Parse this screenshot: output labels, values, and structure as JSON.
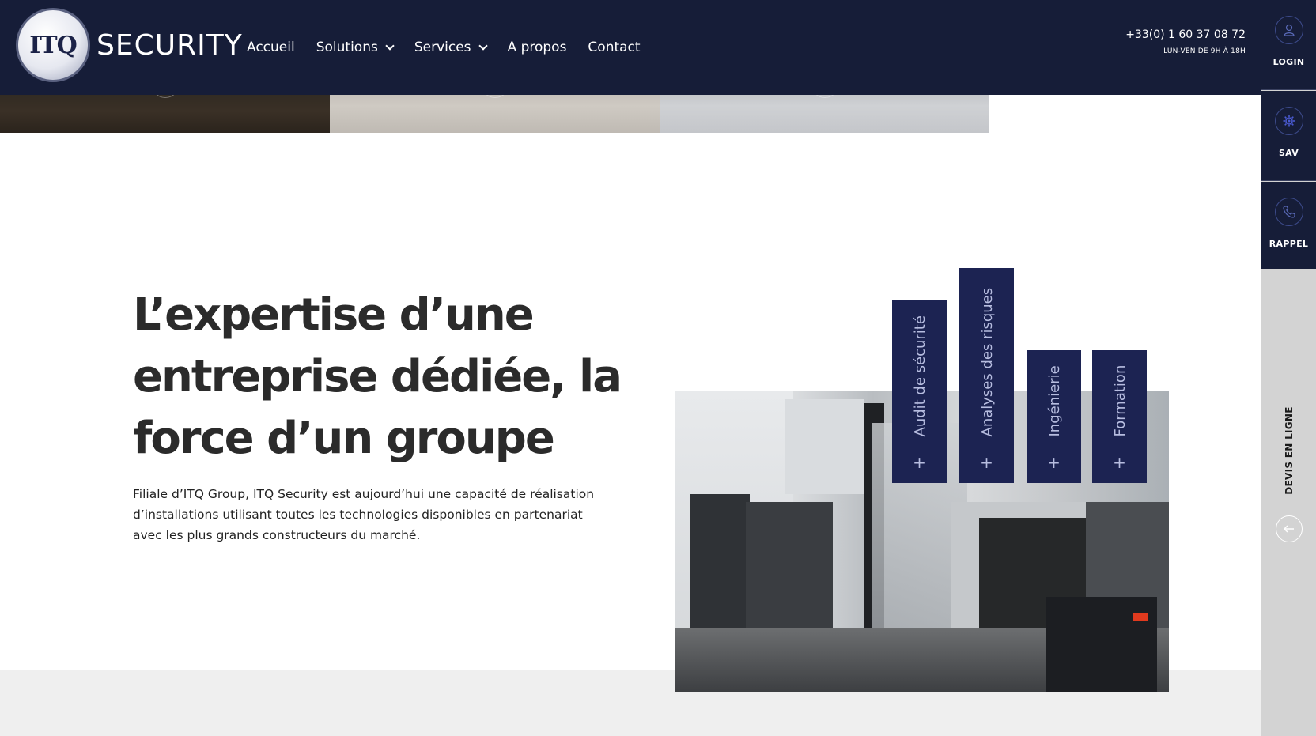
{
  "brand": {
    "logo_mark": "ITQ",
    "logo_word": "SECURITY",
    "navy": "#161d38",
    "tab_color": "#1c2352"
  },
  "nav": {
    "items": [
      {
        "label": "Accueil",
        "has_dropdown": false
      },
      {
        "label": "Solutions",
        "has_dropdown": true
      },
      {
        "label": "Services",
        "has_dropdown": true
      },
      {
        "label": "A propos",
        "has_dropdown": false
      },
      {
        "label": "Contact",
        "has_dropdown": false
      }
    ]
  },
  "contact": {
    "phone": "+33(0) 1 60 37 08 72",
    "hours": "LUN-VEN DE 9H À 18H"
  },
  "sidebar": {
    "buttons": [
      {
        "label": "LOGIN",
        "icon": "user-icon"
      },
      {
        "label": "SAV",
        "icon": "gear-icon"
      },
      {
        "label": "RAPPEL",
        "icon": "phone-icon"
      }
    ],
    "devis_label": "DEVIS EN LIGNE",
    "devis_icon": "arrow-left-icon"
  },
  "hero": {
    "title_lines": [
      "L’expertise d’une",
      "entreprise dédiée, la",
      "force d’un groupe"
    ],
    "text": "Filiale d’ITQ Group, ITQ Security est aujourd’hui une capacité de réalisation d’installations utilisant toutes les technologies disponibles en partenariat avec les plus grands constructeurs du marché."
  },
  "service_tabs": [
    {
      "label": "Audit de sécurité",
      "plus": "+"
    },
    {
      "label": "Analyses des risques",
      "plus": "+"
    },
    {
      "label": "Ingénierie",
      "plus": "+"
    },
    {
      "label": "Formation",
      "plus": "+"
    }
  ]
}
